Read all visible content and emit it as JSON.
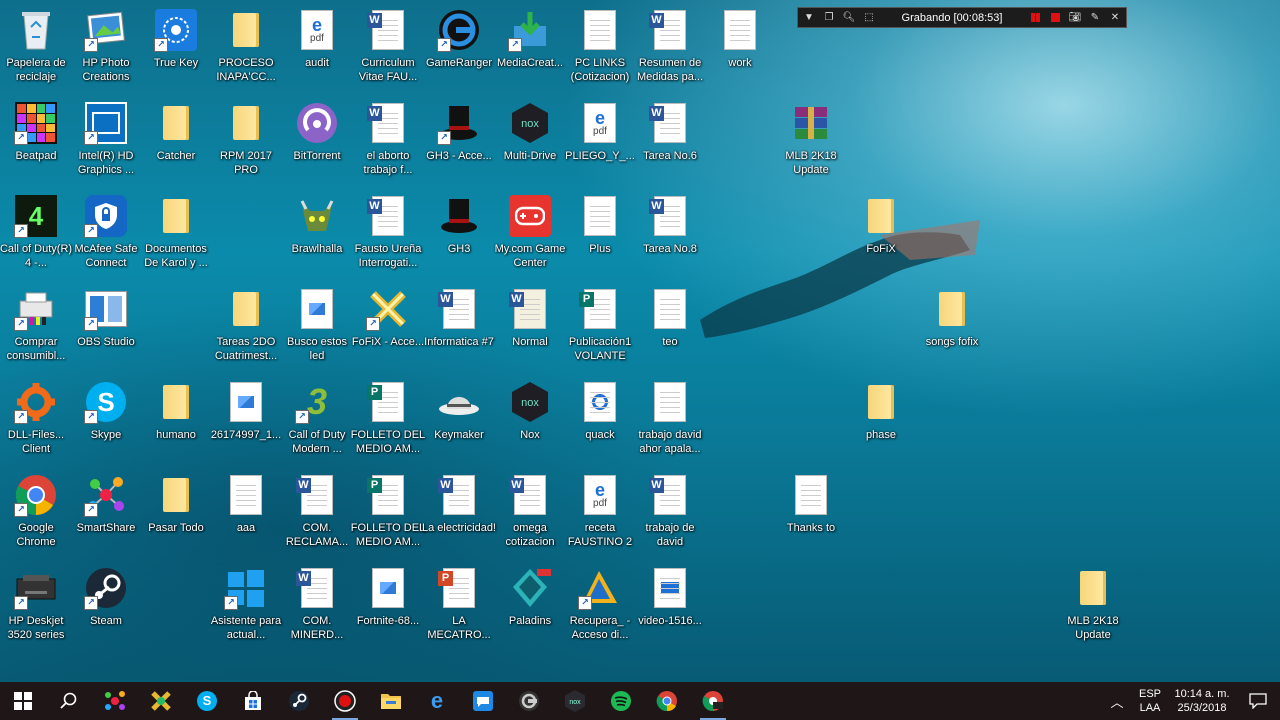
{
  "recorder": {
    "status": "Grabando [00:08:53]"
  },
  "taskbar": {
    "lang_top": "ESP",
    "lang_bottom": "LAA",
    "time": "10:14 a. m.",
    "date": "25/3/2018"
  },
  "icons": {
    "c1": [
      "Papelera de reciclaje",
      "Beatpad",
      "Call of Duty(R) 4 -...",
      "Comprar consumibl...",
      "DLL-Files... Client",
      "Google Chrome",
      "HP Deskjet 3520 series"
    ],
    "c2": [
      "HP Photo Creations",
      "Intel(R) HD Graphics ...",
      "McAfee Safe Connect",
      "OBS Studio",
      "Skype",
      "SmartShare",
      "Steam"
    ],
    "c3": [
      "True Key",
      "Catcher",
      "Documentos De Karol y ...",
      "humano",
      "Pasar Todo"
    ],
    "c4": [
      "PROCESO INAPA'CC...",
      "RPM 2017 PRO",
      "Tareas 2DO Cuatrimest...",
      "26174997_1...",
      "aaa",
      "Asistente para actual..."
    ],
    "c5": [
      "audit",
      "BitTorrent",
      "Brawlhalla",
      "Busco estos led",
      "Call of Duty Modern ...",
      "COM. RECLAMA...",
      "COM. MINERD..."
    ],
    "c6": [
      "Curriculum Vitae FAU...",
      "el aborto trabajo f...",
      "Fausto Ureña Interrogati...",
      "FoFiX - Acce...",
      "FOLLETO DEL MEDIO AM...",
      "FOLLETO DEL MEDIO AM...",
      "Fortnite-68..."
    ],
    "c7": [
      "GameRanger",
      "GH3 - Acce...",
      "GH3",
      "Informatica #7",
      "Keymaker",
      "La electricidad!",
      "LA MECATRO..."
    ],
    "c8": [
      "MediaCreat...",
      "Multi-Drive",
      "My.com Game Center",
      "Normal",
      "Nox",
      "omega cotizacion",
      "Paladins"
    ],
    "c9": [
      "PC LINKS (Cotizacion)",
      "PLIEGO_Y_...",
      "Plus",
      "Publicación1 VOLANTE",
      "quack",
      "receta FAUSTINO 2",
      "Recupera_ - Acceso di..."
    ],
    "c10": [
      "Resumen de Medidas pa...",
      "Tarea No.6",
      "Tarea No.8",
      "teo",
      "trabajo david ahor apala...",
      "trabajo de david",
      "video-1516..."
    ],
    "c11": [
      "work"
    ],
    "c12": [
      "Thanks to"
    ],
    "c13": [
      "MLB 2K18 Update",
      "FoFiX",
      "phase"
    ],
    "c14": [
      "songs fofix"
    ],
    "c15": [
      "MLB 2K18 Update"
    ]
  }
}
